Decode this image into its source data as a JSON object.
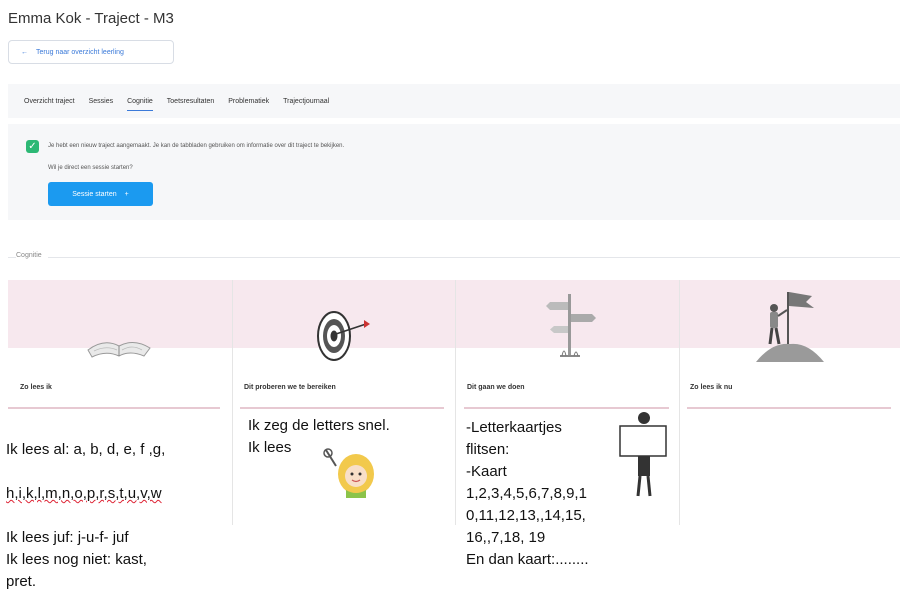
{
  "header": {
    "title": "Emma Kok - Traject - M3"
  },
  "back_button": {
    "label": "Terug naar overzicht leerling",
    "icon": "arrow-left-icon"
  },
  "tabs": [
    {
      "label": "Overzicht traject"
    },
    {
      "label": "Sessies"
    },
    {
      "label": "Cognitie",
      "active": true
    },
    {
      "label": "Toetsresultaten"
    },
    {
      "label": "Problematiek"
    },
    {
      "label": "Trajectjournaal"
    }
  ],
  "notice": {
    "text": "Je hebt een nieuw traject aangemaakt. Je kan de tabbladen gebruiken om informatie over dit traject te bekijken.",
    "question": "Wil je direct een sessie starten?",
    "button_label": "Sessie starten",
    "button_icon": "plus-icon"
  },
  "section": {
    "label": "Cognitie"
  },
  "cards": [
    {
      "title": "Zo lees ik",
      "icon": "open-book-icon",
      "line1": "Ik lees al: a, b, d, e, f ,g,",
      "line2": "h,i,k,l,m,n,o,p,r,s,t,u,v,w",
      "rest": "Ik lees juf: j-u-f- juf\nIk lees nog niet: kast,\npret."
    },
    {
      "title": "Dit proberen we te bereiken",
      "icon": "target-icon",
      "text": "Ik zeg de letters snel.\nIk lees"
    },
    {
      "title": "Dit gaan we doen",
      "icon": "signpost-icon",
      "text": "-Letterkaartjes\nflitsen:\n-Kaart\n1,2,3,4,5,6,7,8,9,1\n0,11,12,13,,14,15,\n16,,7,18, 19\nEn dan kaart:........"
    },
    {
      "title": "Zo lees ik nu",
      "icon": "flag-mountain-icon"
    }
  ],
  "colors": {
    "accent": "#1b9af0",
    "check": "#2db875",
    "band": "#f7e8ee",
    "underline": "#e7c9d2"
  }
}
